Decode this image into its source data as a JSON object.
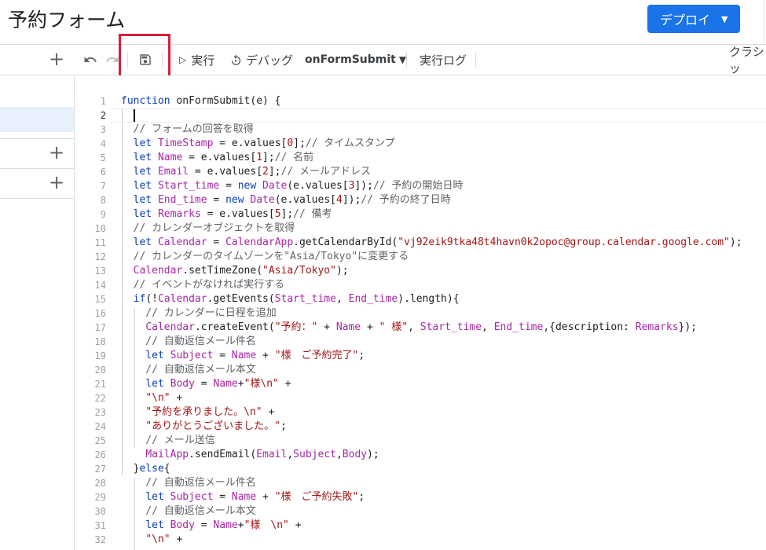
{
  "header": {
    "title": "予約フォーム",
    "deploy_label": "デプロイ"
  },
  "toolbar": {
    "run_label": "実行",
    "debug_label": "デバッグ",
    "function_select": "onFormSubmit",
    "log_label": "実行ログ",
    "classic_label": "クラシッ"
  },
  "editor": {
    "line_numbers": [
      "1",
      "2",
      "3",
      "4",
      "5",
      "6",
      "7",
      "8",
      "9",
      "10",
      "11",
      "12",
      "13",
      "14",
      "15",
      "16",
      "17",
      "18",
      "19",
      "20",
      "21",
      "22",
      "23",
      "24",
      "25",
      "26",
      "27",
      "28",
      "29",
      "30",
      "31",
      "32"
    ],
    "lines": [
      [
        {
          "t": "function ",
          "c": "kw"
        },
        {
          "t": "onFormSubmit(e) {",
          "c": "pl"
        }
      ],
      [
        {
          "t": "",
          "c": "pl"
        }
      ],
      [
        {
          "t": "  // フォームの回答を取得",
          "c": "cm"
        }
      ],
      [
        {
          "t": "  let ",
          "c": "kw"
        },
        {
          "t": "TimeStamp",
          "c": "vr"
        },
        {
          "t": " = e.values[",
          "c": "pl"
        },
        {
          "t": "0",
          "c": "num"
        },
        {
          "t": "];",
          "c": "pl"
        },
        {
          "t": "// タイムスタンプ",
          "c": "cm"
        }
      ],
      [
        {
          "t": "  let ",
          "c": "kw"
        },
        {
          "t": "Name",
          "c": "vr"
        },
        {
          "t": " = e.values[",
          "c": "pl"
        },
        {
          "t": "1",
          "c": "num"
        },
        {
          "t": "];",
          "c": "pl"
        },
        {
          "t": "// 名前",
          "c": "cm"
        }
      ],
      [
        {
          "t": "  let ",
          "c": "kw"
        },
        {
          "t": "Email",
          "c": "vr"
        },
        {
          "t": " = e.values[",
          "c": "pl"
        },
        {
          "t": "2",
          "c": "num"
        },
        {
          "t": "];",
          "c": "pl"
        },
        {
          "t": "// メールアドレス",
          "c": "cm"
        }
      ],
      [
        {
          "t": "  let ",
          "c": "kw"
        },
        {
          "t": "Start_time",
          "c": "vr"
        },
        {
          "t": " = ",
          "c": "pl"
        },
        {
          "t": "new ",
          "c": "kw"
        },
        {
          "t": "Date",
          "c": "vr"
        },
        {
          "t": "(e.values[",
          "c": "pl"
        },
        {
          "t": "3",
          "c": "num"
        },
        {
          "t": "]);",
          "c": "pl"
        },
        {
          "t": "// 予約の開始日時",
          "c": "cm"
        }
      ],
      [
        {
          "t": "  let ",
          "c": "kw"
        },
        {
          "t": "End_time",
          "c": "vr"
        },
        {
          "t": " = ",
          "c": "pl"
        },
        {
          "t": "new ",
          "c": "kw"
        },
        {
          "t": "Date",
          "c": "vr"
        },
        {
          "t": "(e.values[",
          "c": "pl"
        },
        {
          "t": "4",
          "c": "num"
        },
        {
          "t": "]);",
          "c": "pl"
        },
        {
          "t": "// 予約の終了日時",
          "c": "cm"
        }
      ],
      [
        {
          "t": "  let ",
          "c": "kw"
        },
        {
          "t": "Remarks",
          "c": "vr"
        },
        {
          "t": " = e.values[",
          "c": "pl"
        },
        {
          "t": "5",
          "c": "num"
        },
        {
          "t": "];",
          "c": "pl"
        },
        {
          "t": "// 備考",
          "c": "cm"
        }
      ],
      [
        {
          "t": "  // カレンダーオブジェクトを取得",
          "c": "cm"
        }
      ],
      [
        {
          "t": "  let ",
          "c": "kw"
        },
        {
          "t": "Calendar",
          "c": "vr"
        },
        {
          "t": " = ",
          "c": "pl"
        },
        {
          "t": "CalendarApp",
          "c": "vr"
        },
        {
          "t": ".getCalendarById(",
          "c": "pl"
        },
        {
          "t": "\"vj92eik9tka48t4havn0k2opoc@group.calendar.google.com\"",
          "c": "st"
        },
        {
          "t": ");",
          "c": "pl"
        }
      ],
      [
        {
          "t": "  // カレンダーのタイムゾーンを\"Asia/Tokyo\"に変更する",
          "c": "cm"
        }
      ],
      [
        {
          "t": "  ",
          "c": "pl"
        },
        {
          "t": "Calendar",
          "c": "vr"
        },
        {
          "t": ".setTimeZone(",
          "c": "pl"
        },
        {
          "t": "\"Asia/Tokyo\"",
          "c": "st"
        },
        {
          "t": ");",
          "c": "pl"
        }
      ],
      [
        {
          "t": "  // イベントがなければ実行する",
          "c": "cm"
        }
      ],
      [
        {
          "t": "  if",
          "c": "kw"
        },
        {
          "t": "(!",
          "c": "pl"
        },
        {
          "t": "Calendar",
          "c": "vr"
        },
        {
          "t": ".getEvents(",
          "c": "pl"
        },
        {
          "t": "Start_time",
          "c": "vr"
        },
        {
          "t": ", ",
          "c": "pl"
        },
        {
          "t": "End_time",
          "c": "vr"
        },
        {
          "t": ").length){",
          "c": "pl"
        }
      ],
      [
        {
          "t": "    // カレンダーに日程を追加",
          "c": "cm"
        }
      ],
      [
        {
          "t": "    ",
          "c": "pl"
        },
        {
          "t": "Calendar",
          "c": "vr"
        },
        {
          "t": ".createEvent(",
          "c": "pl"
        },
        {
          "t": "\"予約：\"",
          "c": "st"
        },
        {
          "t": " + ",
          "c": "pl"
        },
        {
          "t": "Name",
          "c": "vr"
        },
        {
          "t": " + ",
          "c": "pl"
        },
        {
          "t": "\" 様\"",
          "c": "st"
        },
        {
          "t": ", ",
          "c": "pl"
        },
        {
          "t": "Start_time",
          "c": "vr"
        },
        {
          "t": ", ",
          "c": "pl"
        },
        {
          "t": "End_time",
          "c": "vr"
        },
        {
          "t": ",{description: ",
          "c": "pl"
        },
        {
          "t": "Remarks",
          "c": "vr"
        },
        {
          "t": "});",
          "c": "pl"
        }
      ],
      [
        {
          "t": "    // 自動返信メール件名",
          "c": "cm"
        }
      ],
      [
        {
          "t": "    let ",
          "c": "kw"
        },
        {
          "t": "Subject",
          "c": "vr"
        },
        {
          "t": " = ",
          "c": "pl"
        },
        {
          "t": "Name",
          "c": "vr"
        },
        {
          "t": " + ",
          "c": "pl"
        },
        {
          "t": "\"様　ご予約完了\"",
          "c": "st"
        },
        {
          "t": ";",
          "c": "pl"
        }
      ],
      [
        {
          "t": "    // 自動返信メール本文",
          "c": "cm"
        }
      ],
      [
        {
          "t": "    let ",
          "c": "kw"
        },
        {
          "t": "Body",
          "c": "vr"
        },
        {
          "t": " = ",
          "c": "pl"
        },
        {
          "t": "Name",
          "c": "vr"
        },
        {
          "t": "+",
          "c": "pl"
        },
        {
          "t": "\"様\\n\"",
          "c": "st"
        },
        {
          "t": " +",
          "c": "pl"
        }
      ],
      [
        {
          "t": "    ",
          "c": "pl"
        },
        {
          "t": "\"\\n\"",
          "c": "st"
        },
        {
          "t": " +",
          "c": "pl"
        }
      ],
      [
        {
          "t": "    ",
          "c": "pl"
        },
        {
          "t": "\"予約を承りました。\\n\"",
          "c": "st"
        },
        {
          "t": " +",
          "c": "pl"
        }
      ],
      [
        {
          "t": "    ",
          "c": "pl"
        },
        {
          "t": "\"ありがとうございました。\"",
          "c": "st"
        },
        {
          "t": ";",
          "c": "pl"
        }
      ],
      [
        {
          "t": "    // メール送信",
          "c": "cm"
        }
      ],
      [
        {
          "t": "    ",
          "c": "pl"
        },
        {
          "t": "MailApp",
          "c": "vr"
        },
        {
          "t": ".sendEmail(",
          "c": "pl"
        },
        {
          "t": "Email",
          "c": "vr"
        },
        {
          "t": ",",
          "c": "pl"
        },
        {
          "t": "Subject",
          "c": "vr"
        },
        {
          "t": ",",
          "c": "pl"
        },
        {
          "t": "Body",
          "c": "vr"
        },
        {
          "t": ");",
          "c": "pl"
        }
      ],
      [
        {
          "t": "  }",
          "c": "pl"
        },
        {
          "t": "else",
          "c": "kw"
        },
        {
          "t": "{",
          "c": "pl"
        }
      ],
      [
        {
          "t": "    // 自動返信メール件名",
          "c": "cm"
        }
      ],
      [
        {
          "t": "    let ",
          "c": "kw"
        },
        {
          "t": "Subject",
          "c": "vr"
        },
        {
          "t": " = ",
          "c": "pl"
        },
        {
          "t": "Name",
          "c": "vr"
        },
        {
          "t": " + ",
          "c": "pl"
        },
        {
          "t": "\"様　ご予約失敗\"",
          "c": "st"
        },
        {
          "t": ";",
          "c": "pl"
        }
      ],
      [
        {
          "t": "    // 自動返信メール本文",
          "c": "cm"
        }
      ],
      [
        {
          "t": "    let ",
          "c": "kw"
        },
        {
          "t": "Body",
          "c": "vr"
        },
        {
          "t": " = ",
          "c": "pl"
        },
        {
          "t": "Name",
          "c": "vr"
        },
        {
          "t": "+",
          "c": "pl"
        },
        {
          "t": "\"様　\\n\"",
          "c": "st"
        },
        {
          "t": " +",
          "c": "pl"
        }
      ],
      [
        {
          "t": "    ",
          "c": "pl"
        },
        {
          "t": "\"\\n\"",
          "c": "st"
        },
        {
          "t": " +",
          "c": "pl"
        }
      ]
    ]
  },
  "colors": {
    "accent": "#1a73e8",
    "highlight": "#d81e3a",
    "keyword": "#0b3db3",
    "variable": "#a626a4",
    "string": "#a31515",
    "comment": "#5f6368"
  },
  "icons": [
    "add-icon",
    "undo-icon",
    "redo-icon",
    "save-icon",
    "run-icon",
    "debug-icon",
    "dropdown-icon"
  ]
}
